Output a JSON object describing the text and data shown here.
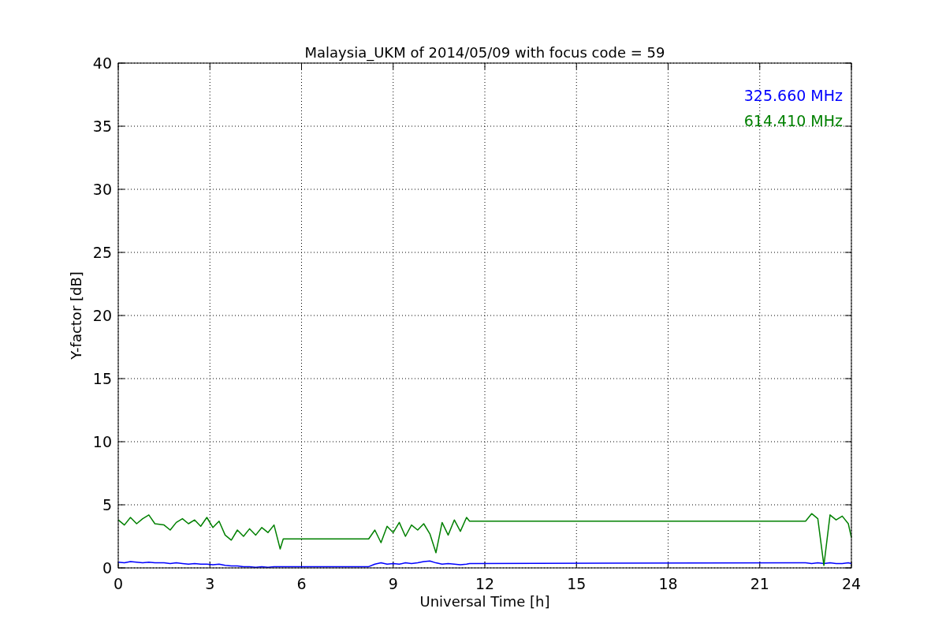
{
  "chart_data": {
    "type": "line",
    "title": "Malaysia_UKM of 2014/05/09 with focus code = 59",
    "xlabel": "Universal Time [h]",
    "ylabel": "Y-factor [dB]",
    "grid": true,
    "xlim": [
      0,
      24
    ],
    "ylim": [
      0,
      40
    ],
    "xticks": [
      0,
      3,
      6,
      9,
      12,
      15,
      18,
      21,
      24
    ],
    "yticks": [
      0,
      5,
      10,
      15,
      20,
      25,
      30,
      35,
      40
    ],
    "x": [
      0,
      0.2,
      0.4,
      0.6,
      0.8,
      1.0,
      1.2,
      1.5,
      1.7,
      1.9,
      2.1,
      2.3,
      2.5,
      2.7,
      2.9,
      3.1,
      3.3,
      3.5,
      3.7,
      3.9,
      4.1,
      4.3,
      4.5,
      4.7,
      4.9,
      5.1,
      5.3,
      5.4,
      8.2,
      8.4,
      8.6,
      8.8,
      9.0,
      9.2,
      9.4,
      9.6,
      9.8,
      10.0,
      10.2,
      10.4,
      10.6,
      10.8,
      11.0,
      11.2,
      11.4,
      11.5,
      22.5,
      22.7,
      22.9,
      23.1,
      23.3,
      23.5,
      23.7,
      23.9,
      24
    ],
    "series": [
      {
        "name": "325.660 MHz",
        "color": "#0000ff",
        "values": [
          0.45,
          0.4,
          0.5,
          0.45,
          0.4,
          0.45,
          0.4,
          0.4,
          0.35,
          0.4,
          0.35,
          0.3,
          0.35,
          0.3,
          0.3,
          0.25,
          0.3,
          0.2,
          0.15,
          0.15,
          0.1,
          0.1,
          0.05,
          0.1,
          0.05,
          0.1,
          0.1,
          0.1,
          0.1,
          0.3,
          0.4,
          0.3,
          0.35,
          0.3,
          0.4,
          0.35,
          0.4,
          0.5,
          0.55,
          0.4,
          0.3,
          0.35,
          0.3,
          0.25,
          0.3,
          0.35,
          0.4,
          0.35,
          0.4,
          0.35,
          0.4,
          0.35,
          0.35,
          0.4,
          0.35
        ]
      },
      {
        "name": "614.410 MHz",
        "color": "#008000",
        "values": [
          3.8,
          3.4,
          4.0,
          3.5,
          3.9,
          4.2,
          3.5,
          3.4,
          3.0,
          3.6,
          3.9,
          3.5,
          3.8,
          3.3,
          4.0,
          3.2,
          3.7,
          2.6,
          2.2,
          3.0,
          2.5,
          3.1,
          2.6,
          3.2,
          2.8,
          3.4,
          1.5,
          2.3,
          2.3,
          3.0,
          2.0,
          3.3,
          2.8,
          3.6,
          2.5,
          3.4,
          3.0,
          3.5,
          2.7,
          1.2,
          3.6,
          2.6,
          3.8,
          2.9,
          4.0,
          3.7,
          3.7,
          4.3,
          3.9,
          0.2,
          4.2,
          3.8,
          4.1,
          3.5,
          2.4
        ]
      }
    ]
  }
}
